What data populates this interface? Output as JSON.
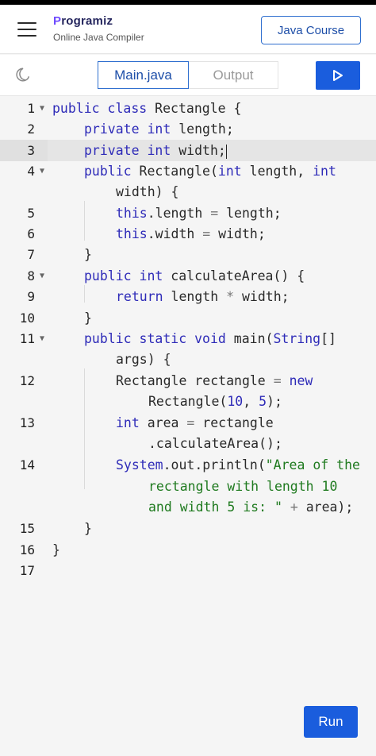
{
  "header": {
    "brand_initial": "P",
    "brand_rest": "rogramiz",
    "subtitle": "Online Java Compiler",
    "course_label": "Java Course"
  },
  "toolbar": {
    "tab_main": "Main.java",
    "tab_output": "Output"
  },
  "editor": {
    "line_numbers": [
      "1",
      "2",
      "3",
      "4",
      "5",
      "6",
      "7",
      "8",
      "9",
      "10",
      "11",
      "12",
      "13",
      "14",
      "15",
      "16",
      "17"
    ],
    "lines": {
      "l1": [
        "public",
        " ",
        "class",
        " Rectangle {"
      ],
      "l2": [
        "private",
        " ",
        "int",
        " length;"
      ],
      "l3": [
        "private",
        " ",
        "int",
        " width;"
      ],
      "l4a": [
        "public",
        " Rectangle(",
        "int",
        " length, ",
        "int"
      ],
      "l4b": "width) {",
      "l5": [
        "this",
        ".length ",
        "=",
        " length;"
      ],
      "l6": [
        "this",
        ".width ",
        "=",
        " width;"
      ],
      "l7": "}",
      "l8": [
        "public",
        " ",
        "int",
        " calculateArea() {"
      ],
      "l9": [
        "return",
        " length ",
        "*",
        " width;"
      ],
      "l10": "}",
      "l11a": [
        "public",
        " ",
        "static",
        " ",
        "void",
        " main(",
        "String",
        "[]"
      ],
      "l11b": "args) {",
      "l12a": [
        "Rectangle rectangle ",
        "=",
        " ",
        "new"
      ],
      "l12b": [
        "Rectangle(",
        "10",
        ", ",
        "5",
        ");"
      ],
      "l13a": [
        "int",
        " area ",
        "=",
        " rectangle"
      ],
      "l13b": ".calculateArea();",
      "l14a": [
        "System",
        ".out.println(",
        "\"Area of the"
      ],
      "l14b": "rectangle with length 10",
      "l14c": [
        "and width 5 is: \"",
        " ",
        "+",
        " area);"
      ],
      "l15": "}",
      "l16": "}"
    }
  },
  "run_button": "Run"
}
